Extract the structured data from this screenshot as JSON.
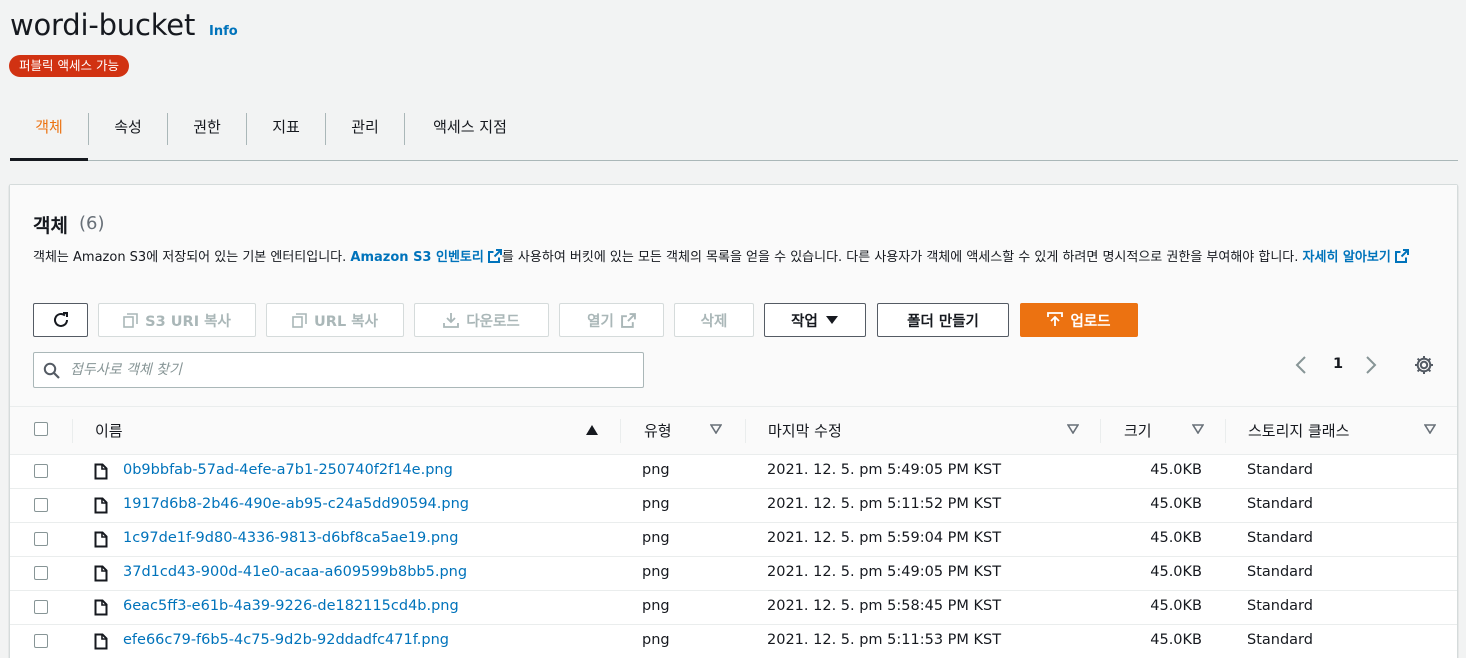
{
  "bucket": {
    "name": "wordi-bucket",
    "info_label": "Info",
    "access_badge": "퍼블릭 액세스 가능"
  },
  "tabs": [
    {
      "label": "객체"
    },
    {
      "label": "속성"
    },
    {
      "label": "권한"
    },
    {
      "label": "지표"
    },
    {
      "label": "관리"
    },
    {
      "label": "액세스 지점"
    }
  ],
  "objects_panel": {
    "title": "객체",
    "count": "(6)",
    "description_prefix": "객체는 Amazon S3에 저장되어 있는 기본 엔터티입니다. ",
    "inventory_link": "Amazon S3 인벤토리",
    "description_middle": "를 사용하여 버킷에 있는 모든 객체의 목록을 얻을 수 있습니다. 다른 사용자가 객체에 액세스할 수 있게 하려면 명시적으로 권한을 부여해야 합니다. ",
    "learn_more_link": "자세히 알아보기"
  },
  "toolbar": {
    "refresh_icon": "refresh-icon",
    "copy_s3_uri": "S3 URI 복사",
    "copy_url": "URL 복사",
    "download": "다운로드",
    "open": "열기",
    "delete": "삭제",
    "actions": "작업",
    "create_folder": "폴더 만들기",
    "upload": "업로드"
  },
  "search": {
    "placeholder": "접두사로 객체 찾기",
    "value": ""
  },
  "pagination": {
    "page": "1"
  },
  "table": {
    "columns": {
      "name": "이름",
      "type": "유형",
      "modified": "마지막 수정",
      "size": "크기",
      "storage_class": "스토리지 클래스"
    },
    "rows": [
      {
        "name": "0b9bbfab-57ad-4efe-a7b1-250740f2f14e.png",
        "type": "png",
        "modified": "2021. 12. 5. pm 5:49:05 PM KST",
        "size": "45.0KB",
        "storage_class": "Standard"
      },
      {
        "name": "1917d6b8-2b46-490e-ab95-c24a5dd90594.png",
        "type": "png",
        "modified": "2021. 12. 5. pm 5:11:52 PM KST",
        "size": "45.0KB",
        "storage_class": "Standard"
      },
      {
        "name": "1c97de1f-9d80-4336-9813-d6bf8ca5ae19.png",
        "type": "png",
        "modified": "2021. 12. 5. pm 5:59:04 PM KST",
        "size": "45.0KB",
        "storage_class": "Standard"
      },
      {
        "name": "37d1cd43-900d-41e0-acaa-a609599b8bb5.png",
        "type": "png",
        "modified": "2021. 12. 5. pm 5:49:05 PM KST",
        "size": "45.0KB",
        "storage_class": "Standard"
      },
      {
        "name": "6eac5ff3-e61b-4a39-9226-de182115cd4b.png",
        "type": "png",
        "modified": "2021. 12. 5. pm 5:58:45 PM KST",
        "size": "45.0KB",
        "storage_class": "Standard"
      },
      {
        "name": "efe66c79-f6b5-4c75-9d2b-92ddadfc471f.png",
        "type": "png",
        "modified": "2021. 12. 5. pm 5:11:53 PM KST",
        "size": "45.0KB",
        "storage_class": "Standard"
      }
    ]
  },
  "colors": {
    "accent": "#ec7211",
    "link": "#0073bb",
    "badge": "#d13212"
  }
}
